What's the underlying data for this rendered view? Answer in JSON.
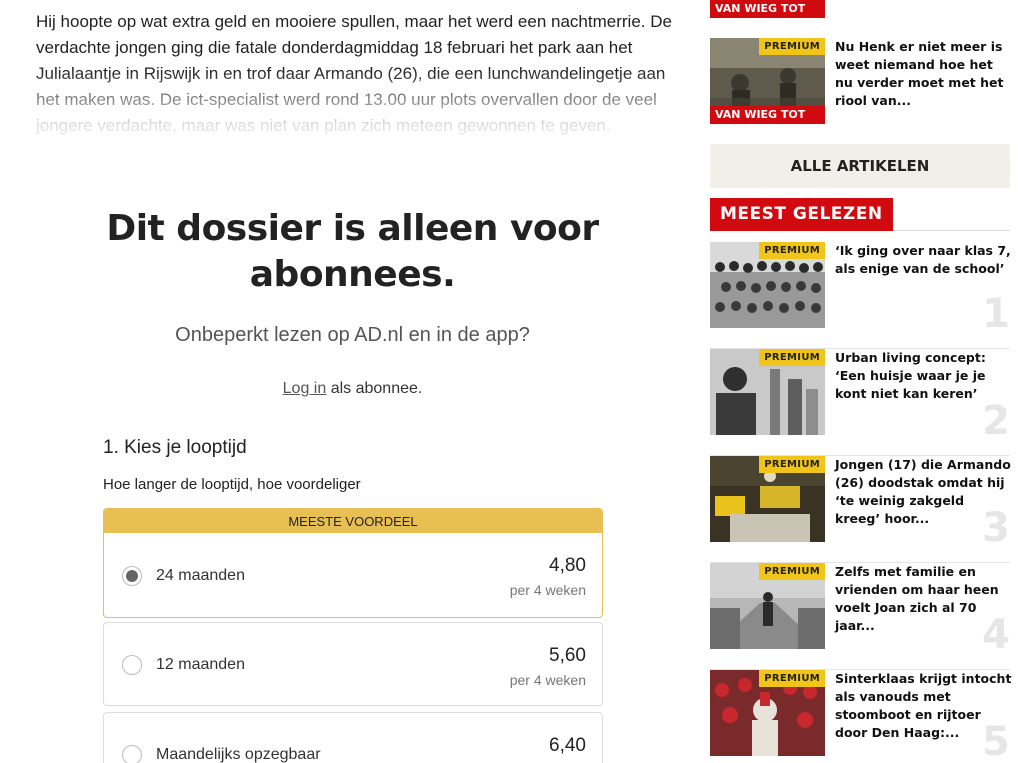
{
  "article": {
    "body": "Hij hoopte op wat extra geld en mooiere spullen, maar het werd een nachtmerrie. De verdachte jongen ging die fatale donderdagmiddag 18 februari het park aan het Julialaantje in Rijswijk in en trof daar Armando (26), die een lunchwandelingetje aan het maken was. De ict-specialist werd rond 13.00 uur plots overvallen door de veel jongere verdachte, maar was niet van plan zich meteen gewonnen te geven."
  },
  "paywall": {
    "title": "Dit dossier is alleen voor abonnees.",
    "subtitle": "Onbeperkt lezen op AD.nl en in de app?",
    "login_link": "Log in",
    "login_suffix": " als abonnee.",
    "step_title": "1. Kies je looptijd",
    "step_desc": "Hoe langer de looptijd, hoe voordeliger",
    "plans": [
      {
        "ribbon": "MEESTE VOORDEEL",
        "label": "24 maanden",
        "price": "4,80",
        "per": "per 4 weken",
        "selected": true
      },
      {
        "label": "12 maanden",
        "price": "5,60",
        "per": "per 4 weken",
        "selected": false
      },
      {
        "label": "Maandelijks opzegbaar",
        "price": "6,40",
        "per": "",
        "selected": false
      }
    ]
  },
  "sidebar": {
    "top_items": [
      {
        "tag": "VAN WIEG TOT GR...",
        "title": ""
      },
      {
        "premium": "PREMIUM",
        "tag": "VAN WIEG TOT GR...",
        "title": "Nu Henk er niet meer is weet niemand hoe het nu verder moet met het riool van..."
      }
    ],
    "all_articles": "ALLE ARTIKELEN",
    "most_read_label": "MEEST GELEZEN",
    "most_read": [
      {
        "premium": "PREMIUM",
        "title": "‘Ik ging over naar klas 7, als enige van de school’",
        "rank": "1"
      },
      {
        "premium": "PREMIUM",
        "title": "Urban living concept: ‘Een huisje waar je je kont niet kan keren’",
        "rank": "2"
      },
      {
        "premium": "PREMIUM",
        "title": "Jongen (17) die Armando (26) doodstak omdat hij ‘te weinig zakgeld kreeg’ hoor...",
        "rank": "3"
      },
      {
        "premium": "PREMIUM",
        "title": "Zelfs met familie en vrienden om haar heen voelt Joan zich al 70 jaar...",
        "rank": "4"
      },
      {
        "premium": "PREMIUM",
        "title": "Sinterklaas krijgt intocht als vanouds met stoomboot en rijtoer door Den Haag:...",
        "rank": "5"
      }
    ]
  },
  "colors": {
    "brand_red": "#d10a10",
    "premium_yellow": "#f0c419",
    "featured_gold": "#e8bf52"
  }
}
